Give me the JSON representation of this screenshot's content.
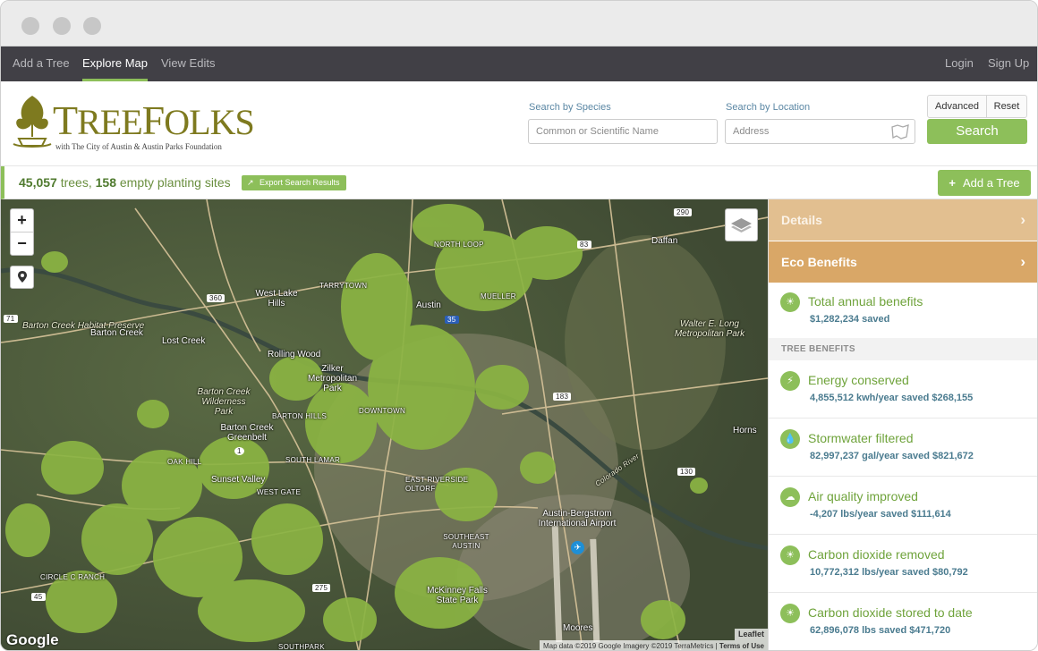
{
  "nav": {
    "left": [
      "Add a Tree",
      "Explore Map",
      "View Edits"
    ],
    "active": "Explore Map",
    "login": "Login",
    "signup": "Sign Up"
  },
  "header": {
    "logo_word": "TreeFolks",
    "logo_sub": "with The City of Austin & Austin Parks Foundation",
    "species_label": "Search by Species",
    "species_placeholder": "Common or Scientific Name",
    "location_label": "Search by Location",
    "location_placeholder": "Address",
    "advanced": "Advanced",
    "reset": "Reset",
    "search": "Search"
  },
  "summary": {
    "trees_count": "45,057",
    "trees_word": "trees,",
    "sites_count": "158",
    "sites_word": "empty planting sites",
    "export": "Export Search Results",
    "add_tree": "Add a Tree"
  },
  "map": {
    "labels": [
      "Barton Creek Habitat Preserve",
      "Barton Creek",
      "West Lake Hills",
      "Lost Creek",
      "Rolling Wood",
      "Zilker Metropolitan Park",
      "Barton Creek Wilderness Park",
      "Barton Creek Greenbelt",
      "Sunset Valley",
      "Austin",
      "Daffan",
      "Walter E. Long Metropolitan Park",
      "Austin-Bergstrom International Airport",
      "McKinney Falls State Park",
      "Moores",
      "Horns",
      "TARRYTOWN",
      "MUELLER",
      "NORTH LOOP",
      "BARTON HILLS",
      "DOWNTOWN",
      "OAK HILL",
      "SOUTH LAMAR",
      "EAST RIVERSIDE OLTORF",
      "SOUTHEAST AUSTIN",
      "CIRCLE C RANCH",
      "WEST GATE",
      "SOUTHPARK",
      "Colorado River"
    ],
    "shields": [
      "290",
      "360",
      "71",
      "1",
      "35",
      "183",
      "130",
      "45",
      "275",
      "83"
    ],
    "google": "Google",
    "leaflet": "Leaflet",
    "attribution": "Map data ©2019 Google Imagery ©2019 TerraMetrics",
    "terms": "Terms of Use",
    "zoom_in": "+",
    "zoom_out": "−"
  },
  "panel": {
    "details": "Details",
    "eco": "Eco Benefits",
    "total_title": "Total annual benefits",
    "total_value": "$1,282,234 saved",
    "tree_benefits": "TREE BENEFITS",
    "benefits": [
      {
        "icon": "lightning-icon",
        "title": "Energy conserved",
        "value": "4,855,512 kwh/year saved $268,155"
      },
      {
        "icon": "water-drop-icon",
        "title": "Stormwater filtered",
        "value": "82,997,237 gal/year saved $821,672"
      },
      {
        "icon": "cloud-icon",
        "title": "Air quality improved",
        "value": "-4,207 lbs/year saved $111,614"
      },
      {
        "icon": "sun-icon",
        "title": "Carbon dioxide removed",
        "value": "10,772,312 lbs/year saved $80,792"
      },
      {
        "icon": "sun-icon",
        "title": "Carbon dioxide stored to date",
        "value": "62,896,078 lbs saved $471,720"
      }
    ]
  },
  "colors": {
    "accent_green": "#8dbf5a",
    "nav_dark": "#414046",
    "details_tan": "#e2bf90",
    "eco_orange": "#d9a767",
    "logo_olive": "#7e7a1f"
  }
}
